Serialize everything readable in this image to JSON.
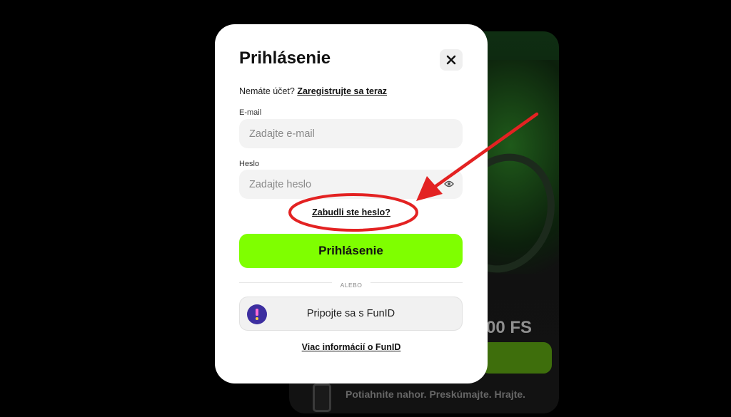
{
  "background": {
    "promo_title": "00 FS",
    "promo_tagline": "Potiahnite nahor. Preskúmajte. Hrajte."
  },
  "modal": {
    "title": "Prihlásenie",
    "register_prompt": "Nemáte účet?",
    "register_link": "Zaregistrujte sa teraz",
    "email": {
      "label": "E-mail",
      "placeholder": "Zadajte e-mail",
      "value": ""
    },
    "password": {
      "label": "Heslo",
      "placeholder": "Zadajte heslo",
      "value": ""
    },
    "forgot_password": "Zabudli ste heslo?",
    "login_button": "Prihlásenie",
    "divider": "ALEBO",
    "funid_button": "Pripojte sa s FunID",
    "funid_info": "Viac informácií o FunID"
  },
  "colors": {
    "accent": "#7fff00",
    "annotation": "#e32222",
    "funid_logo": "#3d2fa0"
  },
  "icons": {
    "close": "close-icon",
    "eye": "eye-icon",
    "funid": "funid-logo-icon"
  }
}
